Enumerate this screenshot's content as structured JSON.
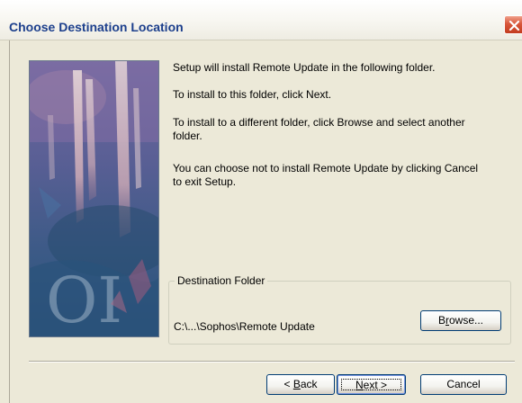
{
  "window": {
    "title": "Choose Destination Location"
  },
  "messages": [
    "Setup will install Remote Update in the following folder.",
    "To install to this folder, click Next.",
    "To install to a different folder, click Browse and select another",
    "folder.",
    "You can choose not to install Remote Update by clicking Cancel",
    "to exit Setup."
  ],
  "destination": {
    "legend": "Destination Folder",
    "path": "C:\\...\\Sophos\\Remote Update",
    "browse_pre": "B",
    "browse_accel": "r",
    "browse_post": "owse..."
  },
  "buttons": {
    "back_pre": "< ",
    "back_accel": "B",
    "back_post": "ack",
    "next_accel": "N",
    "next_post": "ext >",
    "cancel": "Cancel"
  },
  "icons": {
    "close": "close-x-icon"
  },
  "colors": {
    "title": "#1c3f8c",
    "close_button": "#c23c1f",
    "dialog_background": "#ece9d8",
    "default_button_border": "#7a96df"
  }
}
